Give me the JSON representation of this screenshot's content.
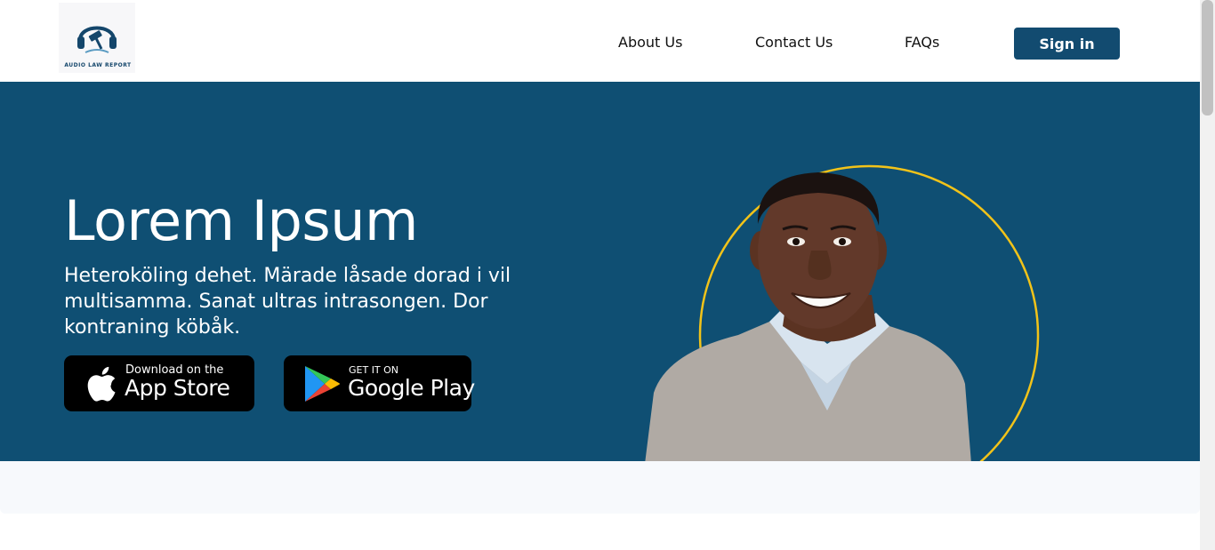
{
  "header": {
    "logo_text": "AUDIO LAW REPORT",
    "nav": {
      "about": "About Us",
      "contact": "Contact Us",
      "faqs": "FAQs"
    },
    "signin_label": "Sign in"
  },
  "hero": {
    "title": "Lorem Ipsum",
    "subtitle": "Heteroköling dehet. Märade låsade dorad i vil multisamma. Sanat ultras intrasongen. Dor kontraning köbåk.",
    "app_store": {
      "small": "Download on the",
      "big": "App Store",
      "icon": "apple-icon"
    },
    "google_play": {
      "small": "GET IT ON",
      "big": "Google Play",
      "icon": "google-play-icon"
    }
  },
  "colors": {
    "hero_bg": "#0f4f73",
    "brand": "#124b70",
    "circle_accent": "#f2c319"
  }
}
